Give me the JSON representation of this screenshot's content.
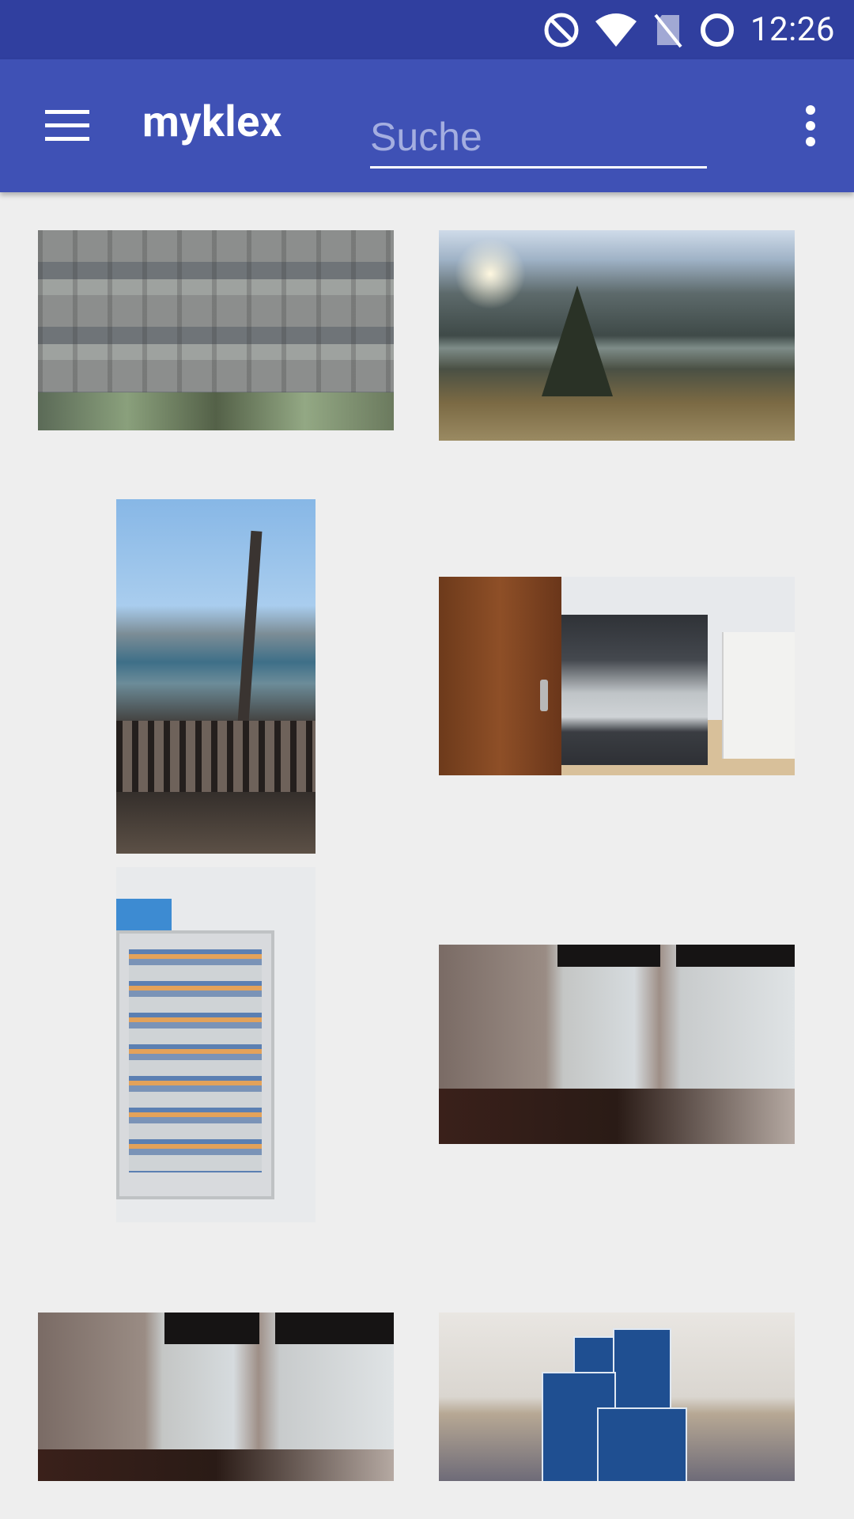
{
  "status_bar": {
    "time": "12:26",
    "icons": [
      "do-not-disturb-icon",
      "wifi-icon",
      "no-sim-icon",
      "sync-icon"
    ]
  },
  "toolbar": {
    "title": "myklex",
    "search_placeholder": "Suche",
    "search_value": "",
    "menu_icon": "hamburger-menu-icon",
    "overflow_icon": "more-vertical-icon"
  },
  "colors": {
    "status_bar": "#303f9f",
    "toolbar": "#3f51b5",
    "background": "#eeeeee"
  }
}
